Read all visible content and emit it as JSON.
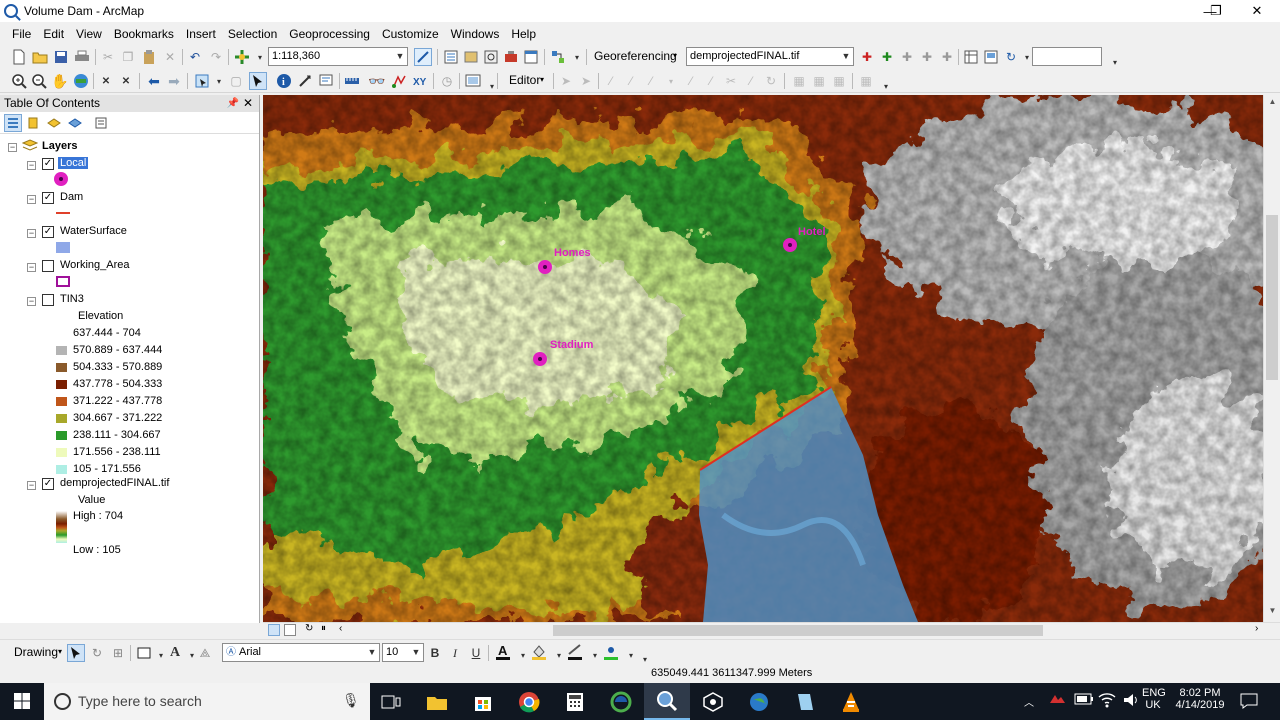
{
  "window": {
    "title": "Volume Dam - ArcMap",
    "min": "—",
    "max": "❐",
    "close": "✕"
  },
  "menu": [
    "File",
    "Edit",
    "View",
    "Bookmarks",
    "Insert",
    "Selection",
    "Geoprocessing",
    "Customize",
    "Windows",
    "Help"
  ],
  "toolbar": {
    "scale": "1:118,360",
    "georef_label": "Georeferencing",
    "georef_layer": "demprojectedFINAL.tif",
    "editor_label": "Editor"
  },
  "toc": {
    "title": "Table Of Contents",
    "root": "Layers",
    "layers": [
      {
        "name": "Local",
        "checked": true
      },
      {
        "name": "Dam",
        "checked": true
      },
      {
        "name": "WaterSurface",
        "checked": true
      },
      {
        "name": "Working_Area",
        "checked": false
      },
      {
        "name": "TIN3",
        "checked": false
      },
      {
        "name": "demprojectedFINAL.tif",
        "checked": true
      }
    ],
    "tin_field": "Elevation",
    "tin_classes": [
      {
        "label": "637.444 - 704",
        "color": "#ffffff"
      },
      {
        "label": "570.889 - 637.444",
        "color": "#b4b4b4"
      },
      {
        "label": "504.333 - 570.889",
        "color": "#8a5a2b"
      },
      {
        "label": "437.778 - 504.333",
        "color": "#7a1e00"
      },
      {
        "label": "371.222 - 437.778",
        "color": "#c0561a"
      },
      {
        "label": "304.667 - 371.222",
        "color": "#a8a82a"
      },
      {
        "label": "238.111 - 304.667",
        "color": "#2a9a2a"
      },
      {
        "label": "171.556 - 238.111",
        "color": "#eefabb"
      },
      {
        "label": "105 - 171.556",
        "color": "#aeeee4"
      }
    ],
    "raster_field": "Value",
    "raster_high": "High : 704",
    "raster_low": "Low : 105"
  },
  "map": {
    "labels": [
      {
        "text": "Hotel"
      },
      {
        "text": "Homes"
      },
      {
        "text": "Stadium"
      }
    ],
    "point_color": "#e020c0"
  },
  "drawing": {
    "label": "Drawing",
    "font": "Arial",
    "size": "10",
    "bold": "B",
    "italic": "I",
    "underline": "U"
  },
  "status": {
    "coords": "635049.441  3611347.999 Meters"
  },
  "taskbar": {
    "search_placeholder": "Type here to search",
    "lang1": "ENG",
    "lang2": "UK",
    "time": "8:02 PM",
    "date": "4/14/2019"
  }
}
